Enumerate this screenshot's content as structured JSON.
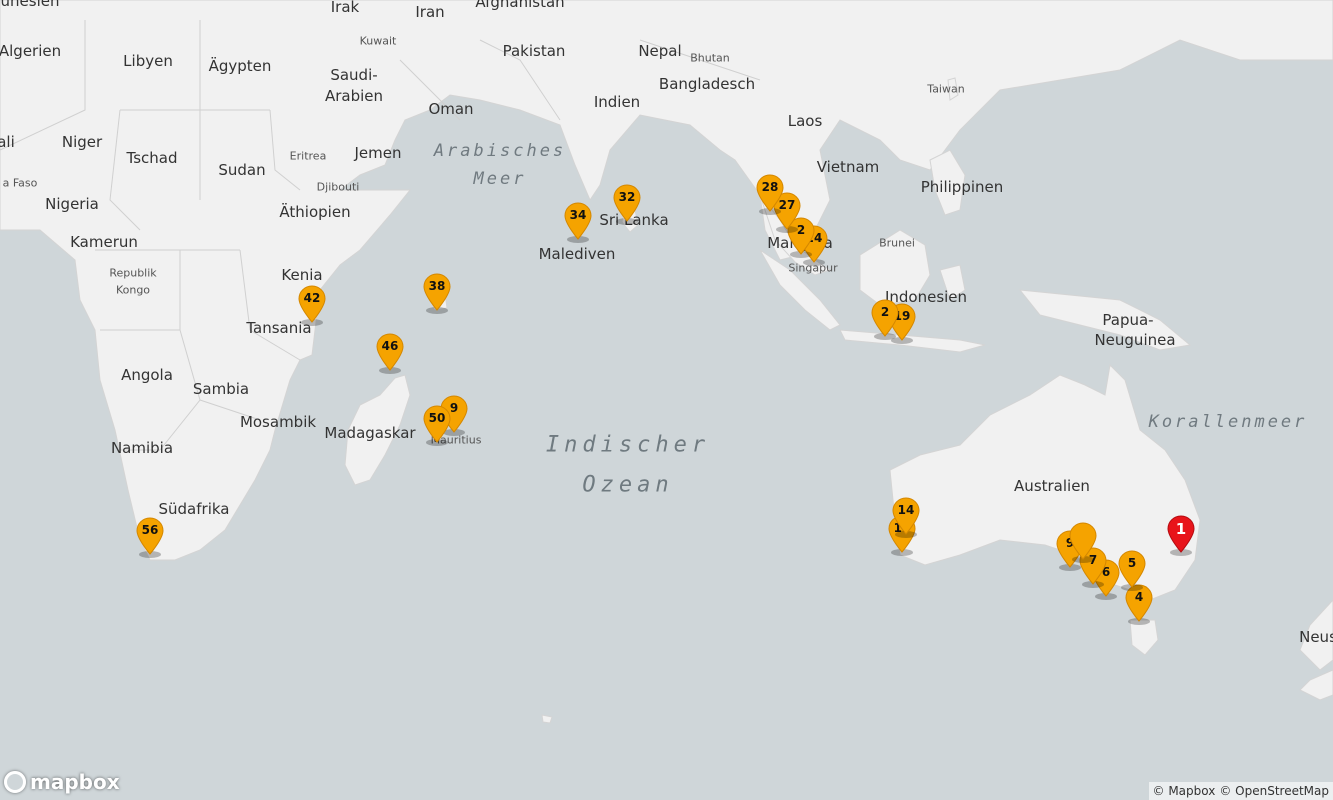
{
  "countries": [
    "Algerien",
    "Libyen",
    "Ägypten",
    "Irak",
    "Iran",
    "Afghanistan",
    "Pakistan",
    "Nepal",
    "Bhutan",
    "Bangladesch",
    "Indien",
    "Kuwait",
    "Saudi-",
    "Arabien",
    "Oman",
    "Jemen",
    "Eritrea",
    "Niger",
    "Tschad",
    "Sudan",
    "Djibouti",
    "Äthiopien",
    "Nigeria",
    "Kamerun",
    "Republik",
    "Kongo",
    "Kenia",
    "Tansania",
    "Angola",
    "Sambia",
    "Mosambik",
    "Madagaskar",
    "Namibia",
    "Südafrika",
    "Sri Lanka",
    "Malediven",
    "Laos",
    "Vietnam",
    "Philippinen",
    "Taiwan",
    "Brunei",
    "Malaysia",
    "Singapur",
    "Indonesien",
    "Papua-",
    "Neuguinea",
    "Australien",
    "Mauritius",
    "Neus",
    "ali",
    "a Faso",
    "unesien"
  ],
  "seas": {
    "arabian_1": "Arabisches",
    "arabian_2": "Meer",
    "ocean_1": "Indischer",
    "ocean_2": "Ozean",
    "coral": "Korallenmeer"
  },
  "markers": [
    {
      "label": "1",
      "color": "#e8141a",
      "selected": true
    },
    {
      "label": "4",
      "color": "#f5a300"
    },
    {
      "label": "5",
      "color": "#f5a300"
    },
    {
      "label": "6",
      "color": "#f5a300"
    },
    {
      "label": "7",
      "color": "#f5a300"
    },
    {
      "label": "9",
      "color": "#f5a300"
    },
    {
      "label": "",
      "color": "#f5a300"
    },
    {
      "label": "13",
      "color": "#f5a300"
    },
    {
      "label": "14",
      "color": "#f5a300"
    },
    {
      "label": "19",
      "color": "#f5a300"
    },
    {
      "label": "2",
      "color": "#f5a300"
    },
    {
      "label": "24",
      "color": "#f5a300"
    },
    {
      "label": "2",
      "color": "#f5a300"
    },
    {
      "label": "27",
      "color": "#f5a300"
    },
    {
      "label": "28",
      "color": "#f5a300"
    },
    {
      "label": "32",
      "color": "#f5a300"
    },
    {
      "label": "34",
      "color": "#f5a300"
    },
    {
      "label": "38",
      "color": "#f5a300"
    },
    {
      "label": "42",
      "color": "#f5a300"
    },
    {
      "label": "46",
      "color": "#f5a300"
    },
    {
      "label": "9",
      "color": "#f5a300"
    },
    {
      "label": "50",
      "color": "#f5a300"
    },
    {
      "label": "56",
      "color": "#f5a300"
    }
  ],
  "logo": {
    "text": "mapbox"
  },
  "attribution": {
    "mapbox": "© Mapbox",
    "osm": "© OpenStreetMap"
  },
  "colors": {
    "water": "#cfd6d9",
    "land": "#f1f1f1",
    "border": "#c8c8c8",
    "marker": "#f5a300",
    "selected": "#e8141a"
  }
}
